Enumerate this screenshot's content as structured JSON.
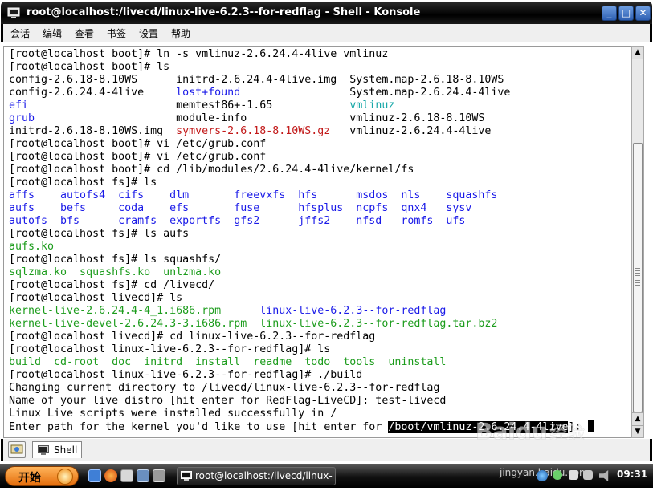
{
  "window": {
    "title": "root@localhost:/livecd/linux-live-6.2.3--for-redflag - Shell - Konsole",
    "controls": {
      "minimize": "_",
      "maximize": "□",
      "close": "✕"
    }
  },
  "menubar": {
    "items": [
      "会话",
      "编辑",
      "查看",
      "书签",
      "设置",
      "帮助"
    ]
  },
  "terminal": {
    "lines": [
      [
        {
          "t": "[root@localhost boot]# ln -s vmlinuz-2.6.24.4-4live vmlinuz",
          "c": ""
        }
      ],
      [
        {
          "t": "[root@localhost boot]# ls",
          "c": ""
        }
      ],
      [
        {
          "t": "config-2.6.18-8.10WS      initrd-2.6.24.4-4live.img  System.map-2.6.18-8.10WS",
          "c": ""
        }
      ],
      [
        {
          "t": "config-2.6.24.4-4live     ",
          "c": ""
        },
        {
          "t": "lost+found",
          "c": "blue"
        },
        {
          "t": "                 System.map-2.6.24.4-4live",
          "c": ""
        }
      ],
      [
        {
          "t": "efi",
          "c": "blue"
        },
        {
          "t": "                       memtest86+-1.65            ",
          "c": ""
        },
        {
          "t": "vmlinuz",
          "c": "cyan"
        }
      ],
      [
        {
          "t": "grub",
          "c": "blue"
        },
        {
          "t": "                      module-info                vmlinuz-2.6.18-8.10WS",
          "c": ""
        }
      ],
      [
        {
          "t": "initrd-2.6.18-8.10WS.img  ",
          "c": ""
        },
        {
          "t": "symvers-2.6.18-8.10WS.gz",
          "c": "red"
        },
        {
          "t": "   vmlinuz-2.6.24.4-4live",
          "c": ""
        }
      ],
      [
        {
          "t": "[root@localhost boot]# vi /etc/grub.conf",
          "c": ""
        }
      ],
      [
        {
          "t": "[root@localhost boot]# vi /etc/grub.conf",
          "c": ""
        }
      ],
      [
        {
          "t": "[root@localhost boot]# cd /lib/modules/2.6.24.4-4live/kernel/fs",
          "c": ""
        }
      ],
      [
        {
          "t": "[root@localhost fs]# ls",
          "c": ""
        }
      ],
      [
        {
          "t": "affs    autofs4  cifs    dlm       freevxfs  hfs      msdos  nls    squashfs",
          "c": "blue"
        }
      ],
      [
        {
          "t": "aufs    befs     coda    efs       fuse      hfsplus  ncpfs  qnx4   sysv",
          "c": "blue"
        }
      ],
      [
        {
          "t": "autofs  bfs      cramfs  exportfs  gfs2      jffs2    nfsd   romfs  ufs",
          "c": "blue"
        }
      ],
      [
        {
          "t": "[root@localhost fs]# ls aufs",
          "c": ""
        }
      ],
      [
        {
          "t": "aufs.ko",
          "c": "green"
        }
      ],
      [
        {
          "t": "[root@localhost fs]# ls squashfs/",
          "c": ""
        }
      ],
      [
        {
          "t": "sqlzma.ko  squashfs.ko  unlzma.ko",
          "c": "green"
        }
      ],
      [
        {
          "t": "[root@localhost fs]# cd /livecd/",
          "c": ""
        }
      ],
      [
        {
          "t": "[root@localhost livecd]# ls",
          "c": ""
        }
      ],
      [
        {
          "t": "kernel-live-2.6.24.4-4_1.i686.rpm",
          "c": "green"
        },
        {
          "t": "      ",
          "c": ""
        },
        {
          "t": "linux-live-6.2.3--for-redflag",
          "c": "blue"
        }
      ],
      [
        {
          "t": "kernel-live-devel-2.6.24.3-3.i686.rpm",
          "c": "green"
        },
        {
          "t": "  ",
          "c": ""
        },
        {
          "t": "linux-live-6.2.3--for-redflag.tar.bz2",
          "c": "green"
        }
      ],
      [
        {
          "t": "[root@localhost livecd]# cd linux-live-6.2.3--for-redflag",
          "c": ""
        }
      ],
      [
        {
          "t": "[root@localhost linux-live-6.2.3--for-redflag]# ls",
          "c": ""
        }
      ],
      [
        {
          "t": "build  cd-root  doc  initrd  install  readme  todo  tools  uninstall",
          "c": "green"
        }
      ],
      [
        {
          "t": "[root@localhost linux-live-6.2.3--for-redflag]# ./build",
          "c": ""
        }
      ],
      [
        {
          "t": "Changing current directory to /livecd/linux-live-6.2.3--for-redflag",
          "c": ""
        }
      ],
      [
        {
          "t": "Name of your live distro [hit enter for RedFlag-LiveCD]: test-livecd",
          "c": ""
        }
      ],
      [
        {
          "t": "Linux Live scripts were installed successfully in /",
          "c": ""
        }
      ],
      [
        {
          "t": "Enter path for the kernel you'd like to use [hit enter for ",
          "c": ""
        },
        {
          "t": "/boot/vmlinuz-2.6.24.4-4live",
          "c": "hl"
        },
        {
          "t": "]: ",
          "c": ""
        },
        {
          "t": "",
          "c": "cursor"
        }
      ]
    ]
  },
  "tabbar": {
    "tab_label": "Shell"
  },
  "taskbar": {
    "start_label": "开始",
    "task_label": "root@localhost:/livecd/linux-li",
    "watermark": "jingyan.baidu.com",
    "clock": "09:31"
  },
  "watermark_logo": "Baidu 经验"
}
